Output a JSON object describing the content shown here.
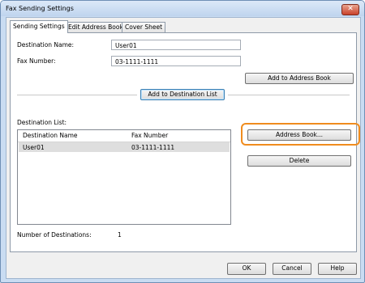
{
  "window": {
    "title": "Fax Sending Settings",
    "close_glyph": "✕"
  },
  "tabs": [
    {
      "label": "Sending Settings"
    },
    {
      "label": "Edit Address Book"
    },
    {
      "label": "Cover Sheet"
    }
  ],
  "form": {
    "destination_name_label": "Destination Name:",
    "destination_name_value": "User01",
    "fax_number_label": "Fax Number:",
    "fax_number_value": "03-1111-1111"
  },
  "buttons": {
    "add_to_address_book": "Add to Address Book",
    "add_to_destination_list": "Add to Destination List",
    "address_book": "Address Book...",
    "delete": "Delete",
    "ok": "OK",
    "cancel": "Cancel",
    "help": "Help"
  },
  "destination_list": {
    "label": "Destination List:",
    "columns": [
      "Destination Name",
      "Fax Number"
    ],
    "rows": [
      {
        "name": "User01",
        "fax": "03-1111-1111"
      }
    ]
  },
  "footer": {
    "count_label": "Number of Destinations:",
    "count_value": "1"
  },
  "colors": {
    "highlight": "#f08c1e",
    "title_bar": "#c9dcf2"
  }
}
